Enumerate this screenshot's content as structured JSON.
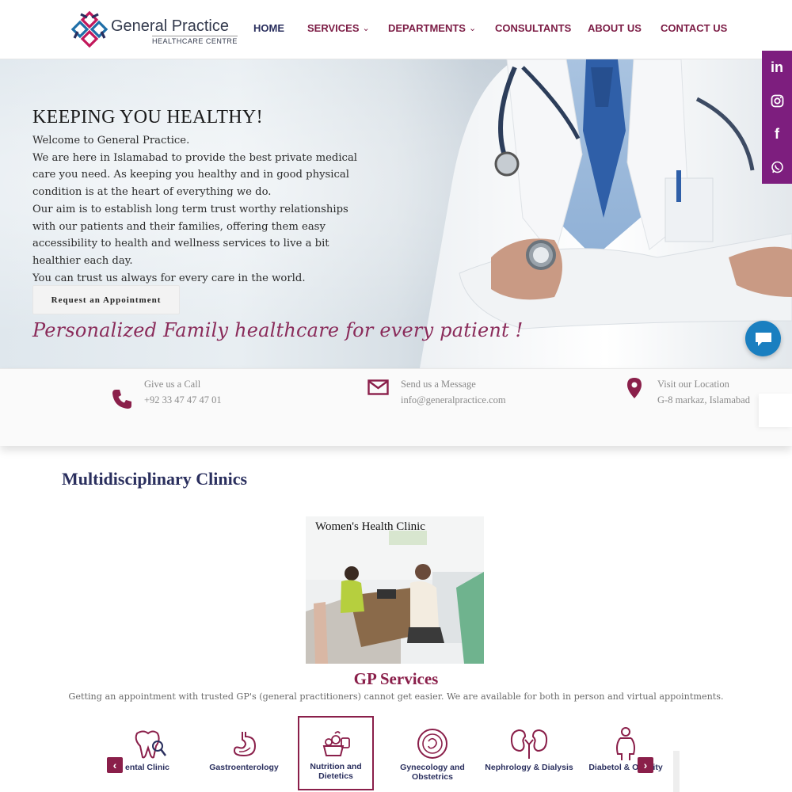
{
  "brand": {
    "name": "General Practice",
    "subtitle": "HEALTHCARE CENTRE",
    "accent": "#8a1f4a",
    "navy": "#2a2f5e"
  },
  "nav": {
    "items": [
      {
        "label": "HOME",
        "active": true
      },
      {
        "label": "SERVICES",
        "dropdown": true
      },
      {
        "label": "DEPARTMENTS",
        "dropdown": true
      },
      {
        "label": "CONSULTANTS"
      },
      {
        "label": "ABOUT US"
      },
      {
        "label": "CONTACT US"
      }
    ]
  },
  "social": {
    "color": "#7d1e7e",
    "items": [
      {
        "icon": "linkedin-icon",
        "glyph": "in"
      },
      {
        "icon": "instagram-icon"
      },
      {
        "icon": "facebook-icon",
        "glyph": "f"
      },
      {
        "icon": "whatsapp-icon"
      }
    ]
  },
  "hero": {
    "title": "KEEPING YOU HEALTHY!",
    "paragraphs": [
      "Welcome to General Practice.",
      "We are here in Islamabad to provide the best private medical care you need. As keeping you healthy and in good physical condition is at the heart of everything we do.",
      "Our aim is to establish long term trust worthy relationships with our patients and their families, offering them easy accessibility to health and wellness services to live a bit healthier each day.",
      "You can trust us always for every care in the world."
    ],
    "cta_label": "Request an Appointment",
    "tagline": "Personalized Family healthcare for every patient !"
  },
  "contact": {
    "call": {
      "label": "Give us a Call",
      "value": "+92 33 47 47 47 01",
      "icon": "phone-icon"
    },
    "message": {
      "label": "Send us a Message",
      "value": "info@generalpractice.com",
      "icon": "envelope-icon"
    },
    "location": {
      "label": "Visit our Location",
      "value": "G-8 markaz, Islamabad",
      "icon": "map-pin-icon"
    }
  },
  "clinics": {
    "section_title": "Multidisciplinary Clinics",
    "featured": {
      "title": "Women's Health Clinic"
    },
    "gp_title": "GP Services",
    "gp_description": "Getting an appointment with trusted GP's (general practitioners) cannot get easier. We are available for both in person and virtual appointments.",
    "carousel": [
      {
        "label": "ental Clinic",
        "icon": "tooth-icon"
      },
      {
        "label": "Gastroenterology",
        "icon": "stomach-icon"
      },
      {
        "label": "Nutrition and Dietetics",
        "icon": "nutrition-icon",
        "selected": true
      },
      {
        "label": "Gynecology and Obstetrics",
        "icon": "womb-icon"
      },
      {
        "label": "Nephrology & Dialysis",
        "icon": "kidney-icon"
      },
      {
        "label": "Diabetol & Obesity",
        "icon": "body-icon"
      }
    ],
    "prev_glyph": "‹",
    "next_glyph": "›"
  }
}
